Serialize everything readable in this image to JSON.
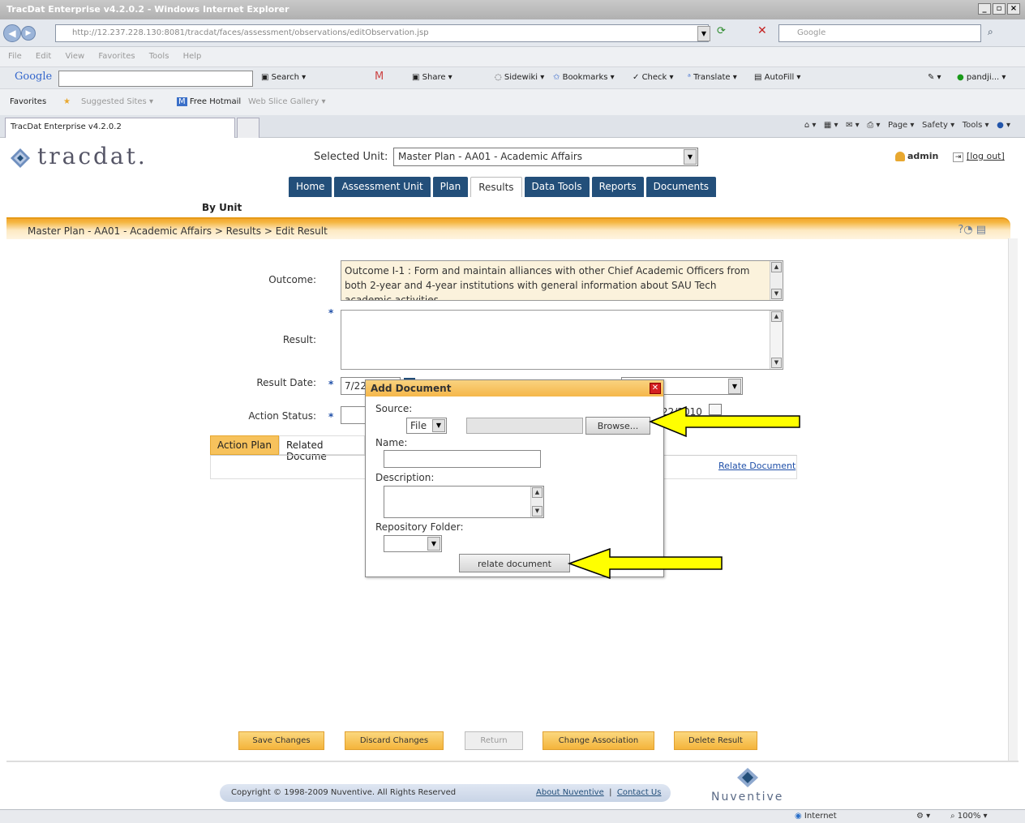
{
  "browser": {
    "title": "TracDat Enterprise v4.2.0.2 - Windows Internet Explorer",
    "address": "http://12.237.228.130:8081/tracdat/faces/assessment/observations/editObservation.jsp",
    "search_placeholder": "Google",
    "menu": [
      "File",
      "Edit",
      "View",
      "Favorites",
      "Tools",
      "Help"
    ],
    "google_toolbar": {
      "label": "Google",
      "items": [
        "Search",
        "Share",
        "Sidewiki",
        "Bookmarks",
        "Check",
        "Translate",
        "AutoFill"
      ],
      "user": "pandji..."
    },
    "favorites": {
      "label": "Favorites",
      "items": [
        "Suggested Sites",
        "Free Hotmail",
        "Web Slice Gallery"
      ]
    },
    "tab_title": "TracDat Enterprise v4.2.0.2",
    "command_items": [
      "Page",
      "Safety",
      "Tools"
    ],
    "status": {
      "zone": "Internet",
      "zoom": "100%"
    }
  },
  "app": {
    "logo_text": "tracdat.",
    "selected_unit_label": "Selected Unit:",
    "selected_unit_value": "Master Plan - AA01 - Academic Affairs",
    "user": "admin",
    "logout": "[log out]",
    "nav_tabs": [
      {
        "label": "Home"
      },
      {
        "label": "Assessment Unit"
      },
      {
        "label": "Plan"
      },
      {
        "label": "Results"
      },
      {
        "label": "Data Tools"
      },
      {
        "label": "Reports"
      },
      {
        "label": "Documents"
      }
    ],
    "sub_nav": "By Unit",
    "breadcrumb": "Master Plan - AA01 - Academic Affairs > Results > Edit Result"
  },
  "form": {
    "outcome_label": "Outcome:",
    "outcome_text": "Outcome I-1 : Form and maintain alliances with other Chief Academic Officers from both 2-year and 4-year institutions with general information about SAU Tech academic activities",
    "result_label": "Result:",
    "result_value": "",
    "result_date_label": "Result Date:",
    "result_date_value": "7/22",
    "action_status_label": "Action Status:",
    "followup_date_partial": "22/2010",
    "sub_tabs": [
      {
        "label": "Action Plan"
      },
      {
        "label": "Related Docume"
      }
    ],
    "relate_document_link": "Relate Document"
  },
  "modal": {
    "title": "Add Document",
    "source_label": "Source:",
    "source_value": "File",
    "browse_label": "Browse...",
    "name_label": "Name:",
    "description_label": "Description:",
    "repository_label": "Repository Folder:",
    "relate_button": "relate document"
  },
  "actions": {
    "save": "Save Changes",
    "discard": "Discard Changes",
    "return": "Return",
    "change": "Change Association",
    "delete": "Delete Result"
  },
  "footer": {
    "copyright": "Copyright © 1998-2009 Nuventive. All Rights Reserved",
    "about": "About Nuventive",
    "contact": "Contact Us",
    "brand": "Nuventive"
  },
  "annotations": {
    "arrow_color": "#ffff00"
  }
}
